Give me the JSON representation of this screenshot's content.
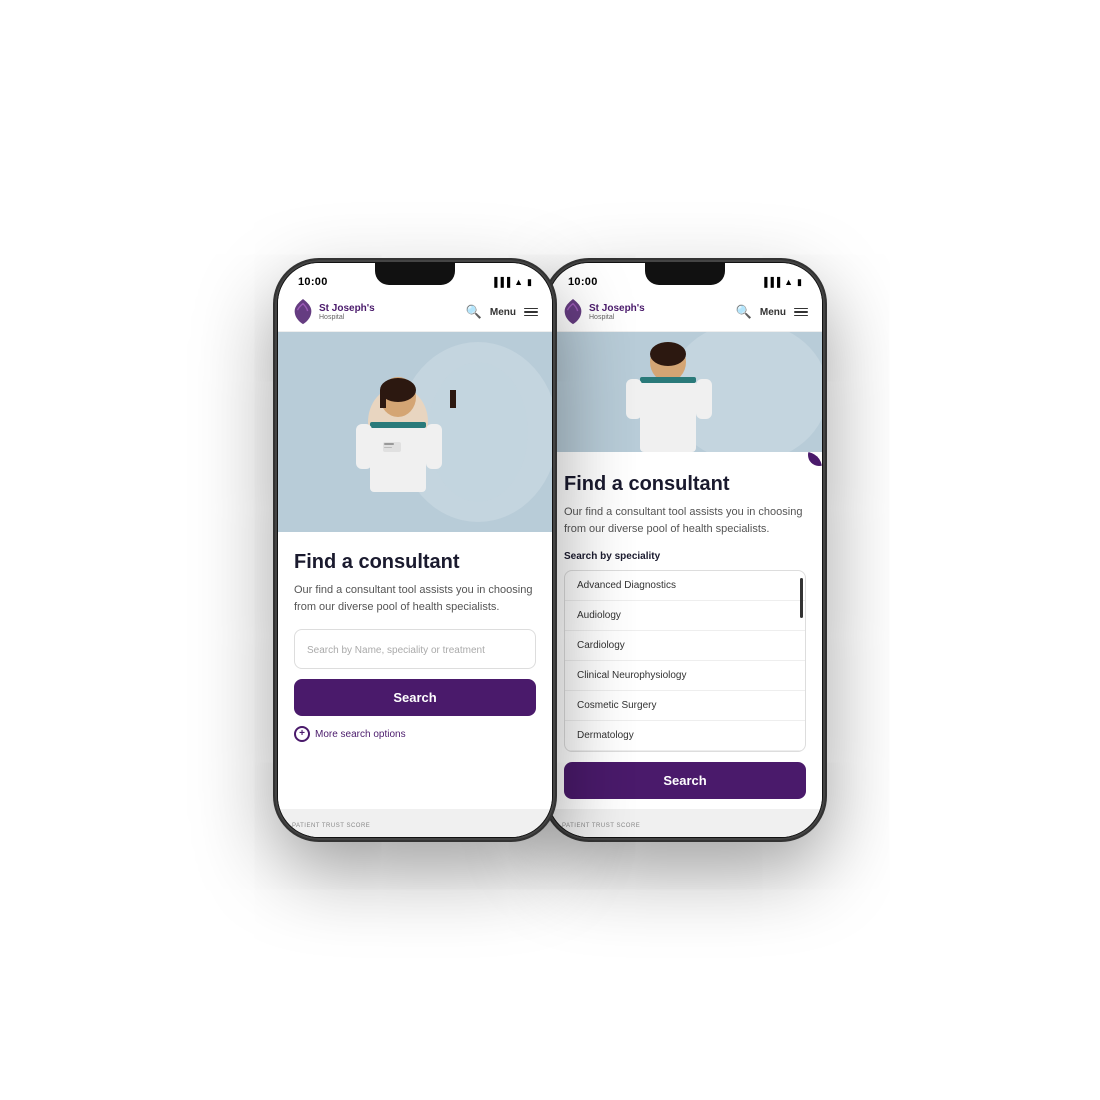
{
  "phones": {
    "phone1": {
      "status_time": "10:00",
      "logo_name": "St Joseph's",
      "logo_sub": "Hospital",
      "menu_label": "Menu",
      "hero_alt": "Healthcare professional in clinical setting",
      "card_title": "Find a consultant",
      "card_desc": "Our find a consultant tool assists you in choosing from our diverse pool of health specialists.",
      "search_placeholder": "Search by Name, speciality or treatment",
      "search_button": "Search",
      "more_options_label": "More search options",
      "trust_score": "PATIENT TRUST SCORE"
    },
    "phone2": {
      "status_time": "10:00",
      "logo_name": "St Joseph's",
      "logo_sub": "Hospital",
      "menu_label": "Menu",
      "card_title": "Find a consultant",
      "card_desc": "Our find a consultant tool assists you in choosing from our diverse pool of health specialists.",
      "speciality_label": "Search by speciality",
      "specialities": [
        "Advanced Diagnostics",
        "Audiology",
        "Cardiology",
        "Clinical Neurophysiology",
        "Cosmetic Surgery",
        "Dermatology"
      ],
      "search_button": "Search",
      "trust_score": "PATIENT TRUST SCORE",
      "close_icon": "+"
    }
  },
  "brand": {
    "primary_color": "#4a1a6b",
    "accent_color": "#fff"
  }
}
